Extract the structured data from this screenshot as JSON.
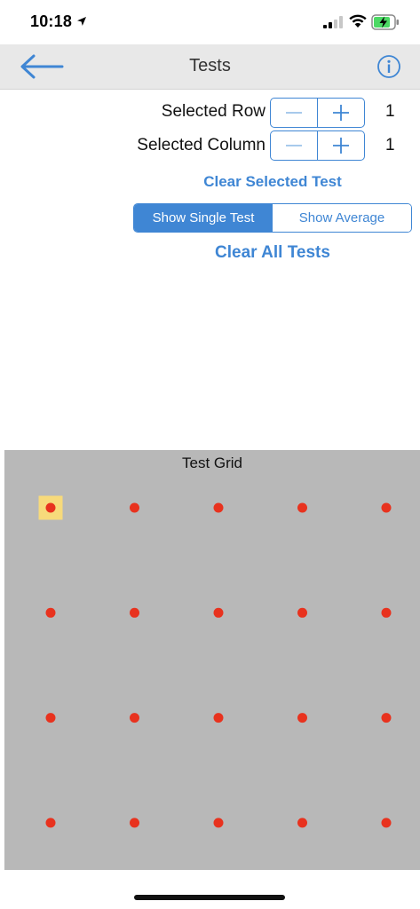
{
  "status": {
    "time": "10:18"
  },
  "nav": {
    "title": "Tests",
    "back_icon": "arrow-left-icon",
    "info_icon": "info-circle-icon"
  },
  "controls": {
    "row_label": "Selected Row",
    "row_value": "1",
    "column_label": "Selected Column",
    "column_value": "1",
    "minus_symbol": "−",
    "plus_symbol": "+",
    "clear_selected_label": "Clear Selected Test",
    "view_options": [
      "Show Single Test",
      "Show Average"
    ],
    "view_selected": "Show Single Test",
    "clear_all_label": "Clear All Tests"
  },
  "grid": {
    "title": "Test Grid",
    "rows": 4,
    "columns": 5,
    "selected_row": 1,
    "selected_column": 1
  },
  "colors": {
    "accent": "#3f86d4",
    "grid_background": "#b8b8b8",
    "point": "#e8321e",
    "selection_highlight": "#f7da7b"
  }
}
